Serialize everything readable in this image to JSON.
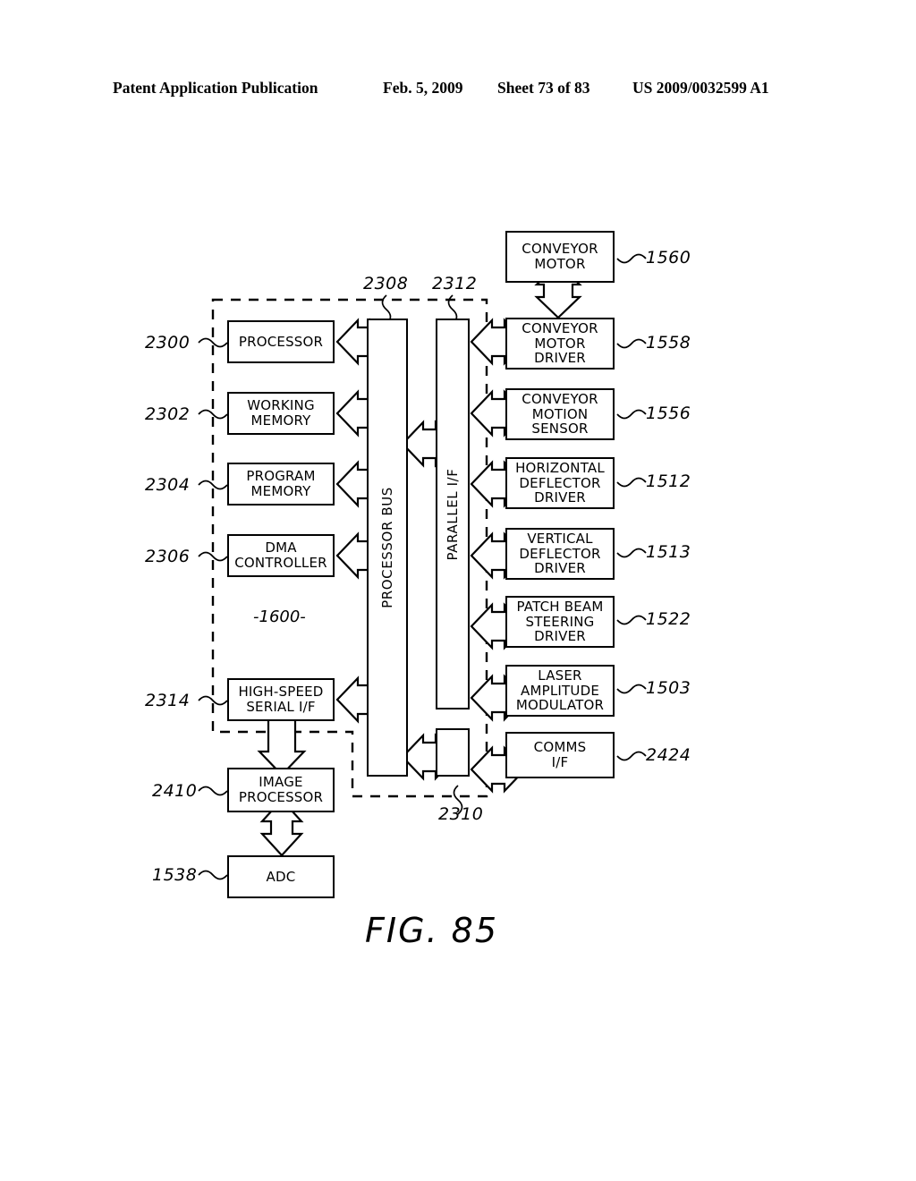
{
  "header": {
    "publication": "Patent Application Publication",
    "date": "Feb. 5, 2009",
    "sheet": "Sheet 73 of 83",
    "patent_number": "US 2009/0032599 A1"
  },
  "figure": {
    "caption": "FIG. 85",
    "inner_label": "-1600-"
  },
  "left_blocks": [
    {
      "id": "processor",
      "ref": "2300",
      "lines": [
        "PROCESSOR"
      ]
    },
    {
      "id": "working-memory",
      "ref": "2302",
      "lines": [
        "WORKING",
        "MEMORY"
      ]
    },
    {
      "id": "program-memory",
      "ref": "2304",
      "lines": [
        "PROGRAM",
        "MEMORY"
      ]
    },
    {
      "id": "dma-controller",
      "ref": "2306",
      "lines": [
        "DMA",
        "CONTROLLER"
      ]
    },
    {
      "id": "high-speed-serial-if",
      "ref": "2314",
      "lines": [
        "HIGH-SPEED",
        "SERIAL I/F"
      ]
    },
    {
      "id": "image-processor",
      "ref": "2410",
      "lines": [
        "IMAGE",
        "PROCESSOR"
      ]
    },
    {
      "id": "adc",
      "ref": "1538",
      "lines": [
        "ADC"
      ]
    }
  ],
  "bus_blocks": [
    {
      "id": "processor-bus",
      "ref": "2308",
      "label": "PROCESSOR BUS"
    },
    {
      "id": "parallel-if",
      "ref": "2312",
      "label": "PARALLEL I/F"
    },
    {
      "id": "serial-if-block",
      "ref": "2310",
      "label": ""
    }
  ],
  "right_blocks": [
    {
      "id": "conveyor-motor",
      "ref": "1560",
      "lines": [
        "CONVEYOR",
        "MOTOR"
      ]
    },
    {
      "id": "conveyor-motor-driver",
      "ref": "1558",
      "lines": [
        "CONVEYOR",
        "MOTOR",
        "DRIVER"
      ]
    },
    {
      "id": "conveyor-motion-sensor",
      "ref": "1556",
      "lines": [
        "CONVEYOR",
        "MOTION",
        "SENSOR"
      ]
    },
    {
      "id": "horizontal-deflector-driver",
      "ref": "1512",
      "lines": [
        "HORIZONTAL",
        "DEFLECTOR",
        "DRIVER"
      ]
    },
    {
      "id": "vertical-deflector-driver",
      "ref": "1513",
      "lines": [
        "VERTICAL",
        "DEFLECTOR",
        "DRIVER"
      ]
    },
    {
      "id": "patch-beam-steering-driver",
      "ref": "1522",
      "lines": [
        "PATCH BEAM",
        "STEERING",
        "DRIVER"
      ]
    },
    {
      "id": "laser-amplitude-modulator",
      "ref": "1503",
      "lines": [
        "LASER",
        "AMPLITUDE",
        "MODULATOR"
      ]
    },
    {
      "id": "comms-if",
      "ref": "2424",
      "lines": [
        "COMMS",
        "I/F"
      ]
    }
  ],
  "colors": {
    "ink": "#000000",
    "paper": "#ffffff"
  }
}
